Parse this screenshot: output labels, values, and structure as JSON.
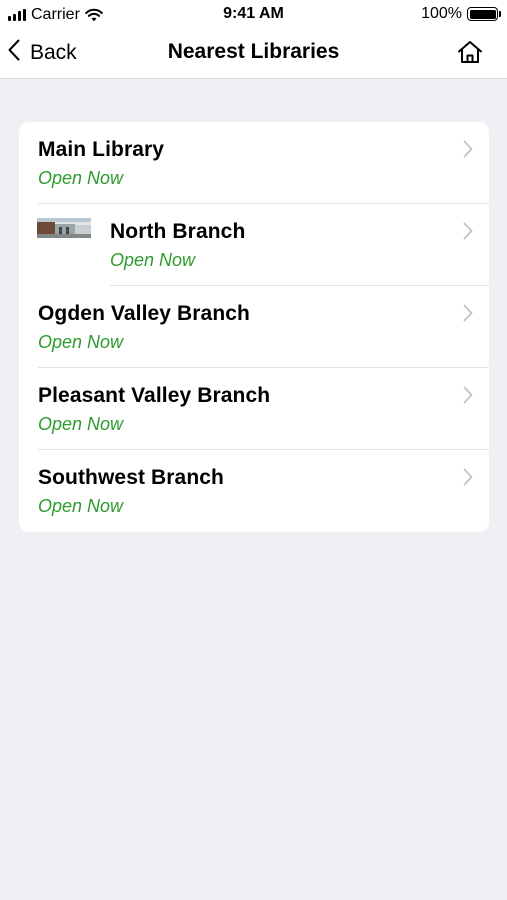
{
  "status_bar": {
    "carrier": "Carrier",
    "time": "9:41 AM",
    "battery": "100%",
    "signal_icon": "signal-bars-icon",
    "wifi_icon": "wifi-icon",
    "battery_icon": "battery-icon"
  },
  "nav": {
    "back_label": "Back",
    "back_icon": "chevron-left-icon",
    "title": "Nearest Libraries",
    "home_icon": "home-icon"
  },
  "libraries": [
    {
      "name": "Main Library",
      "status": "Open Now",
      "has_thumbnail": false
    },
    {
      "name": "North Branch",
      "status": "Open Now",
      "has_thumbnail": true
    },
    {
      "name": "Ogden Valley Branch",
      "status": "Open Now",
      "has_thumbnail": false
    },
    {
      "name": "Pleasant Valley Branch",
      "status": "Open Now",
      "has_thumbnail": false
    },
    {
      "name": "Southwest Branch",
      "status": "Open Now",
      "has_thumbnail": false
    }
  ],
  "colors": {
    "background": "#efeff4",
    "open_status": "#2e9b2e",
    "chevron": "#c4c4c7"
  }
}
